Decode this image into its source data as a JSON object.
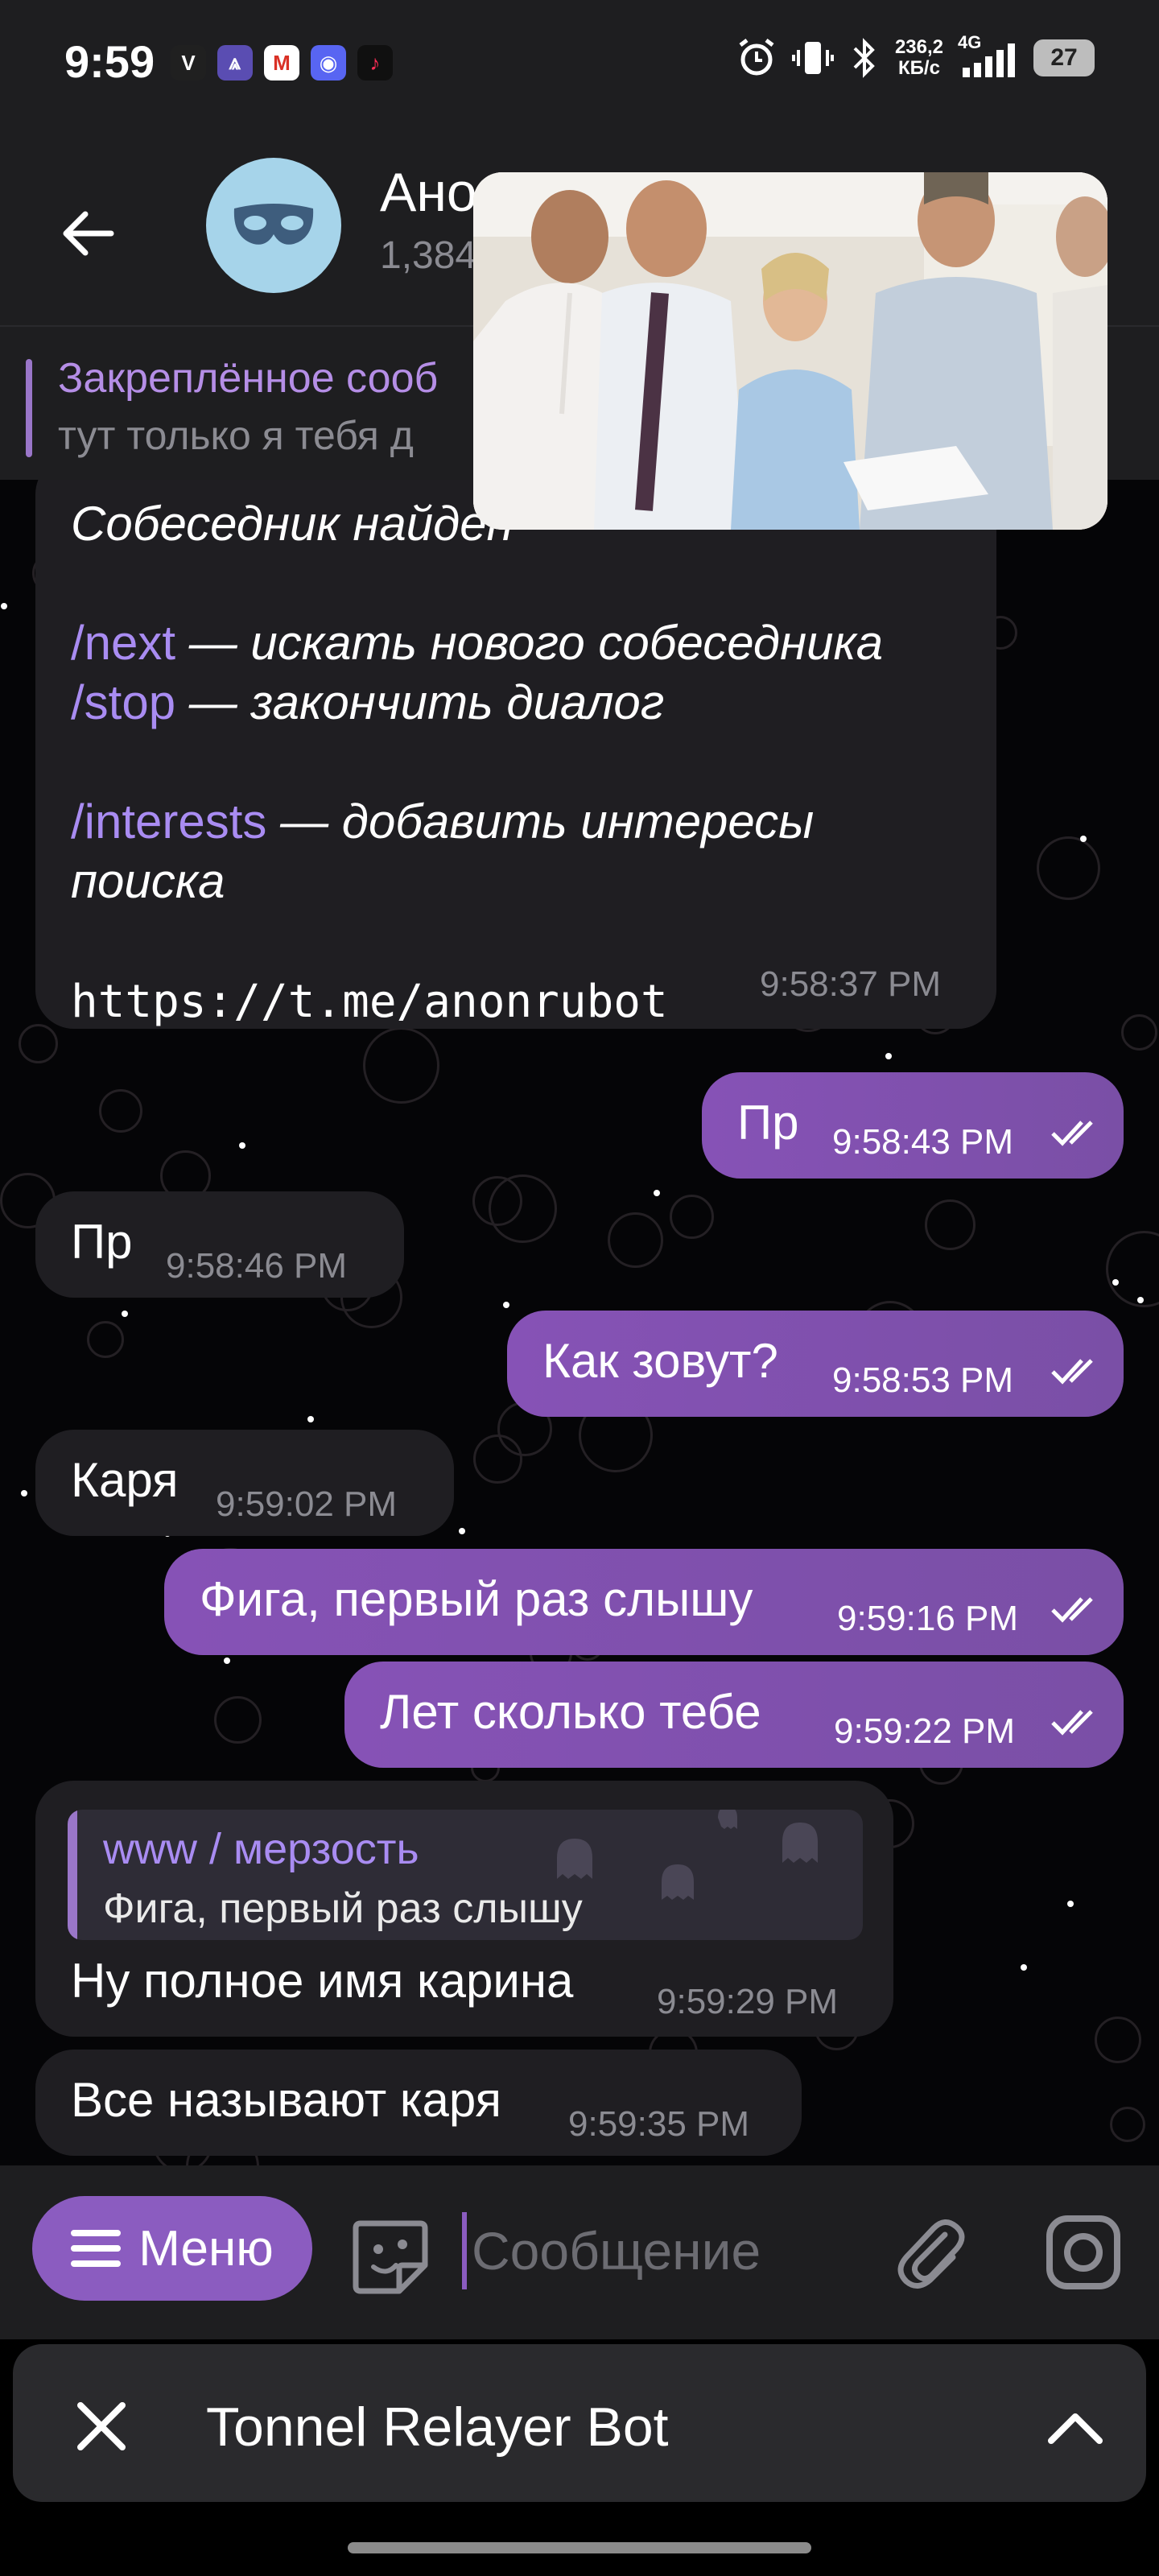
{
  "status_bar": {
    "time": "9:59",
    "apps": [
      {
        "name": "vk-app-icon",
        "glyph": "V",
        "bg": "#202020",
        "fg": "#ffffff"
      },
      {
        "name": "proton-vpn-icon",
        "glyph": "⩓",
        "bg": "#5a4db2",
        "fg": "#ffffff"
      },
      {
        "name": "gmail-icon",
        "glyph": "M",
        "bg": "#ffffff",
        "fg": "#d93025"
      },
      {
        "name": "discord-icon",
        "glyph": "◉",
        "bg": "#5865f2",
        "fg": "#ffffff"
      },
      {
        "name": "tiktok-icon",
        "glyph": "♪",
        "bg": "#101010",
        "fg": "#ff2d55"
      }
    ],
    "net_speed_value": "236,2",
    "net_speed_unit": "КБ/с",
    "network": "4G",
    "battery": "27"
  },
  "header": {
    "title": "Ано",
    "subtitle": "1,384"
  },
  "pinned": {
    "title": "Закреплённое сооб",
    "text": "тут только я тебя д"
  },
  "messages": [
    {
      "lines": [
        {
          "parts": [
            {
              "t": "Собеседник найден",
              "c": "it"
            }
          ]
        },
        {
          "parts": [
            {
              "t": "",
              "c": ""
            }
          ]
        },
        {
          "parts": [
            {
              "t": "/next",
              "c": "cmd"
            },
            {
              "t": " — искать нового собеседника",
              "c": "it"
            }
          ]
        },
        {
          "parts": [
            {
              "t": "/stop",
              "c": "cmd"
            },
            {
              "t": " — закончить диалог",
              "c": "it"
            }
          ]
        },
        {
          "parts": [
            {
              "t": "",
              "c": ""
            }
          ]
        },
        {
          "parts": [
            {
              "t": "/interests",
              "c": "cmd"
            },
            {
              "t": " — добавить интересы",
              "c": "it"
            }
          ]
        },
        {
          "parts": [
            {
              "t": "поиска",
              "c": "it"
            }
          ]
        },
        {
          "parts": [
            {
              "t": "",
              "c": ""
            }
          ]
        },
        {
          "parts": [
            {
              "t": "https://t.me/anonrubot",
              "c": "mono"
            }
          ]
        }
      ],
      "time": "9:58:37 PM"
    },
    {
      "text": "Пр",
      "time": "9:58:43 PM"
    },
    {
      "text": "Пр",
      "time": "9:58:46 PM"
    },
    {
      "text": "Как зовут?",
      "time": "9:58:53 PM"
    },
    {
      "text": "Каря",
      "time": "9:59:02 PM"
    },
    {
      "text": "Фига, первый раз слышу",
      "time": "9:59:16 PM"
    },
    {
      "text": "Лет сколько тебе",
      "time": "9:59:22 PM"
    },
    {
      "reply_author": "www / мерзость",
      "reply_text": "Фига, первый раз слышу",
      "text": "Ну полное имя карина",
      "time": "9:59:29 PM"
    },
    {
      "text": "Все называют каря",
      "time": "9:59:35 PM"
    }
  ],
  "input_bar": {
    "menu_label": "Меню",
    "placeholder": "Сообщение"
  },
  "bot_bar": {
    "title": "Tonnel Relayer Bot"
  },
  "colors": {
    "outgoing_bubble": "#8652b6",
    "incoming_bubble": "#1f1e22",
    "accent": "#a98cf2",
    "header_bg": "#1e1e20"
  }
}
